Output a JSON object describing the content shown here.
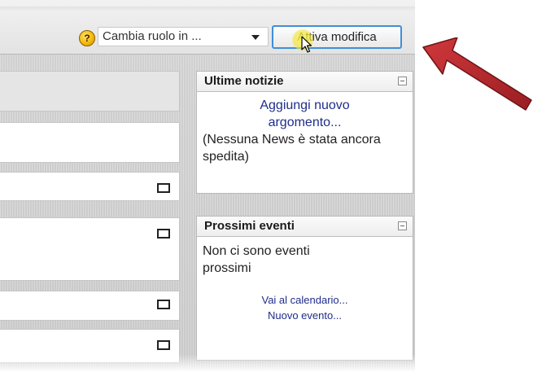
{
  "toolbar": {
    "help_glyph": "?",
    "role_select_value": "Cambia ruolo in ...",
    "edit_button_label": "Attiva modifica"
  },
  "news_block": {
    "title": "Ultime notizie",
    "add_link": "Aggiungi nuovo argomento...",
    "empty_text": "(Nessuna News è stata ancora spedita)"
  },
  "events_block": {
    "title": "Prossimi eventi",
    "empty_text": "Non ci sono eventi prossimi",
    "calendar_link": "Vai al calendario...",
    "new_event_link": "Nuovo evento..."
  },
  "colors": {
    "annotation_arrow": "#b3262a",
    "button_border": "#3f8fd8",
    "link": "#1f2d8a"
  }
}
